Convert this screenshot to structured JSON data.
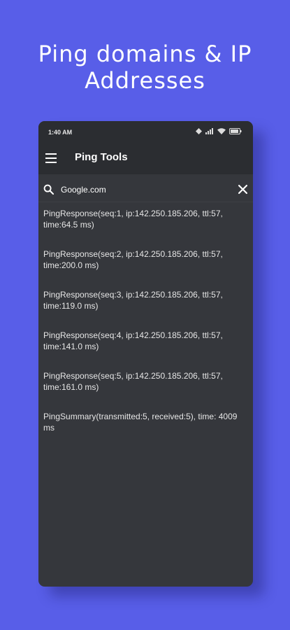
{
  "promo": {
    "title_line1": "Ping domains & IP",
    "title_line2": "Addresses"
  },
  "status_bar": {
    "time": "1:40 AM",
    "icons": [
      "data-sync-icon",
      "signal-icon",
      "wifi-icon",
      "battery-icon"
    ]
  },
  "app_bar": {
    "title": "Ping Tools",
    "menu_icon": "menu-icon"
  },
  "search": {
    "value": "Google.com",
    "search_icon": "search-icon",
    "clear_icon": "close-icon"
  },
  "results": [
    {
      "text": "PingResponse(seq:1, ip:142.250.185.206, ttl:57, time:64.5 ms)"
    },
    {
      "text": "PingResponse(seq:2, ip:142.250.185.206, ttl:57, time:200.0 ms)"
    },
    {
      "text": "PingResponse(seq:3, ip:142.250.185.206, ttl:57, time:119.0 ms)"
    },
    {
      "text": "PingResponse(seq:4, ip:142.250.185.206, ttl:57, time:141.0 ms)"
    },
    {
      "text": "PingResponse(seq:5, ip:142.250.185.206, ttl:57, time:161.0 ms)"
    },
    {
      "text": "PingSummary(transmitted:5, received:5), time: 4009 ms"
    }
  ],
  "colors": {
    "background": "#585ee8",
    "surface": "#35373c",
    "app_bar": "#2b2d31",
    "text": "#e6e6e6"
  }
}
